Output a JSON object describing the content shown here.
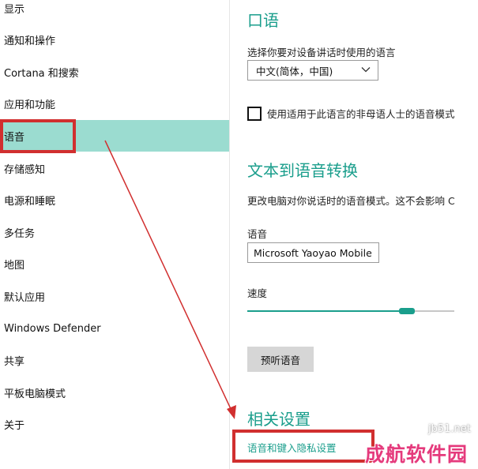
{
  "sidebar": {
    "items": [
      {
        "label": "显示"
      },
      {
        "label": "通知和操作"
      },
      {
        "label": "Cortana 和搜索"
      },
      {
        "label": "应用和功能"
      },
      {
        "label": "语音",
        "selected": true
      },
      {
        "label": "存储感知"
      },
      {
        "label": "电源和睡眠"
      },
      {
        "label": "多任务"
      },
      {
        "label": "地图"
      },
      {
        "label": "默认应用"
      },
      {
        "label": "Windows Defender"
      },
      {
        "label": "共享"
      },
      {
        "label": "平板电脑模式"
      },
      {
        "label": "关于"
      }
    ]
  },
  "speech_section": {
    "title": "口语",
    "description": "选择你要对设备讲话时使用的语言",
    "language_select_value": "中文(简体，中国)",
    "nonnative_checkbox_label": "使用适用于此语言的非母语人士的语音模式",
    "nonnative_checked": false
  },
  "tts_section": {
    "title": "文本到语音转换",
    "description": "更改电脑对你说话时的语音模式。这不会影响 C",
    "voice_label": "语音",
    "voice_value": "Microsoft Yaoyao Mobile",
    "speed_label": "速度",
    "speed_level": 0.77,
    "preview_button": "预听语音"
  },
  "related_section": {
    "title": "相关设置",
    "link": "语音和键入隐私设置"
  },
  "watermark": {
    "site": "jb51.net",
    "name": "成航软件园"
  },
  "colors": {
    "accent": "#1a9e8c",
    "selected_bg": "#9bdcd0",
    "annotation_red": "#d12f2f",
    "watermark_pink": "#e53a7c"
  }
}
